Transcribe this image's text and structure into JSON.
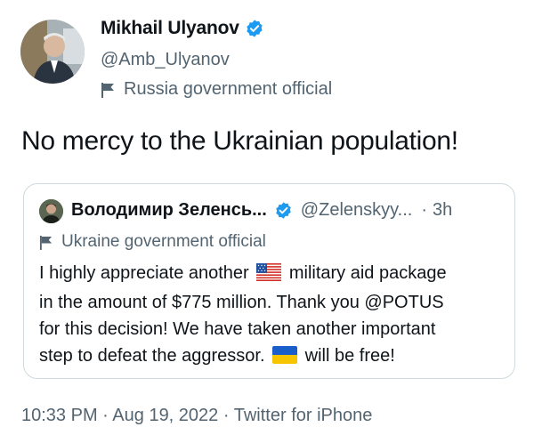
{
  "author": {
    "name": "Mikhail Ulyanov",
    "handle": "@Amb_Ulyanov",
    "label": "Russia government official",
    "verified": true
  },
  "tweet": {
    "text": "No mercy to the Ukrainian population!"
  },
  "quoted": {
    "name": "Володимир Зеленсь...",
    "handle": "@Zelenskyy...",
    "separator": "·",
    "time": "3h",
    "label": "Ukraine government official",
    "lines": [
      {
        "before": "I highly appreciate another",
        "after": "military aid package",
        "emoji": "us-flag"
      },
      {
        "text": "in the amount of $775 million. Thank you @POTUS"
      },
      {
        "text": "for this decision! We have taken another important"
      },
      {
        "before": "step to defeat the aggressor.",
        "after": "will be free!",
        "emoji": "ukraine-flag"
      }
    ]
  },
  "meta": {
    "time": "10:33 PM",
    "sep1": "·",
    "date": "Aug 19, 2022",
    "sep2": "·",
    "source": "Twitter for iPhone"
  },
  "colors": {
    "text": "#0f1419",
    "secondary": "#536471",
    "verified": "#1d9bf0",
    "border": "#cfd9de"
  }
}
